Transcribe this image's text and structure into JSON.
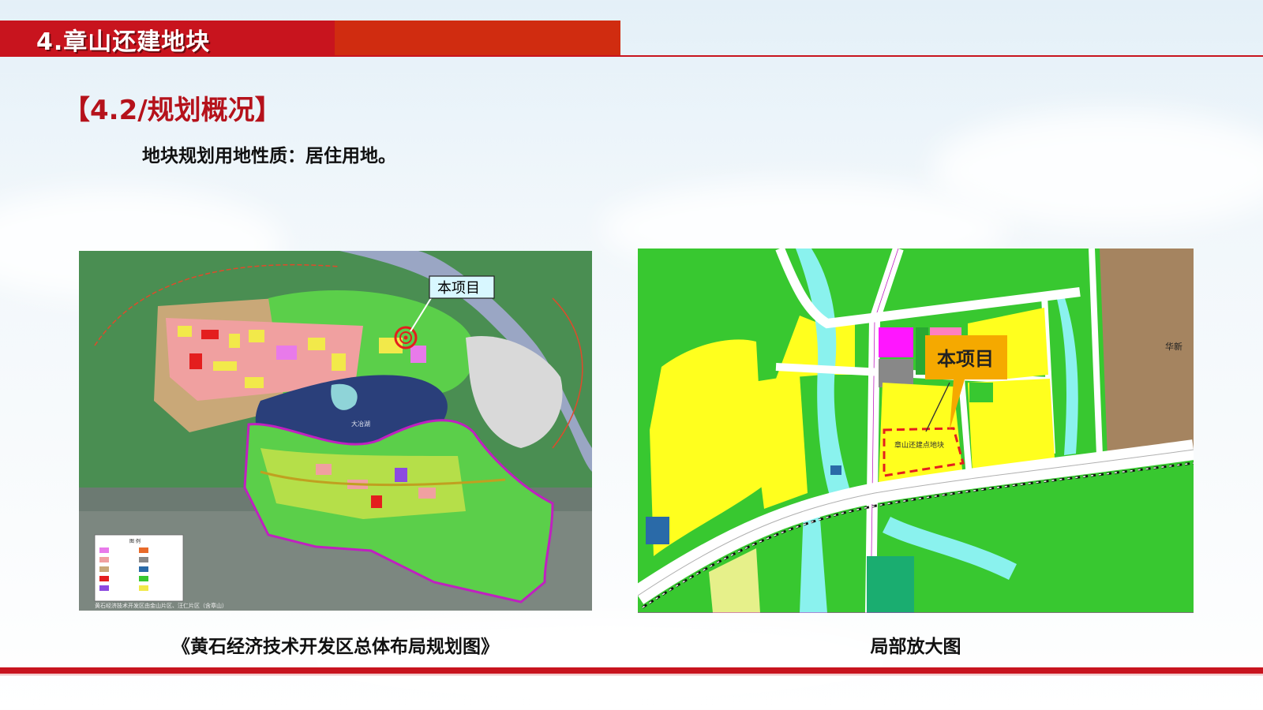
{
  "header": {
    "title": "4.章山还建地块"
  },
  "section": {
    "title": "【4.2/规划概况】"
  },
  "subtitle": "地块规划用地性质：居住用地。",
  "left_map": {
    "caption": "《黄石经济技术开发区总体布局规划图》",
    "callout": "本项目",
    "lake_label": "大冶湖",
    "legend_title": "图  例",
    "footer_note": "黄石经济技术开发区由金山片区、汪仁片区（含章山）",
    "colors": {
      "green": "#55c846",
      "dark_green": "#2f7d3a",
      "lake": "#2a3f7a",
      "pink": "#f0a0a0",
      "yellow": "#f2e94a",
      "boundary": "#c020c0"
    }
  },
  "right_map": {
    "caption": "局部放大图",
    "callout": "本项目",
    "parcel_label": "章山还建点地块",
    "edge_label": "华新",
    "colors": {
      "green": "#38c830",
      "yellow": "#ffff1e",
      "cyan": "#8af2ee",
      "brown": "#a58460",
      "magenta": "#ff16ff",
      "gray": "#888888",
      "callout": "#f5a900"
    }
  },
  "colors": {
    "accent_red": "#c8141e",
    "accent_orange": "#d02c10"
  }
}
